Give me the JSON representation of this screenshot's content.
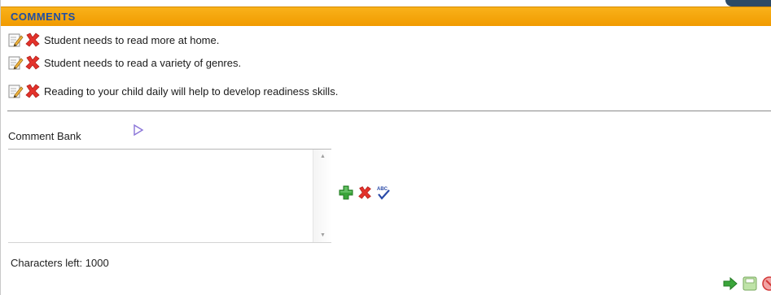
{
  "section": {
    "title": "COMMENTS"
  },
  "comments": [
    {
      "text": "Student needs to read more at home.",
      "edit_icon": "edit-icon",
      "delete_icon": "delete-icon"
    },
    {
      "text": "Student needs to read a variety of genres.",
      "edit_icon": "edit-icon",
      "delete_icon": "delete-icon"
    },
    {
      "text": "Reading to your child daily will help to develop readiness skills.",
      "edit_icon": "edit-icon",
      "delete_icon": "delete-icon"
    }
  ],
  "comment_bank": {
    "label": "Comment Bank",
    "expand_icon": "play-arrow-icon"
  },
  "editor": {
    "value": "",
    "characters_left_label": "Characters left:",
    "characters_left_value": "1000",
    "tools": [
      "add-icon",
      "delete-icon",
      "spellcheck-icon"
    ]
  },
  "footer_actions": [
    "next-arrow-icon",
    "save-icon",
    "cancel-icon"
  ],
  "colors": {
    "header_bg": "#f4a40a",
    "header_text": "#1f4ea3",
    "delete_red": "#e4322b",
    "add_green": "#3aa53a",
    "arrow_purple": "#8a74d8"
  }
}
